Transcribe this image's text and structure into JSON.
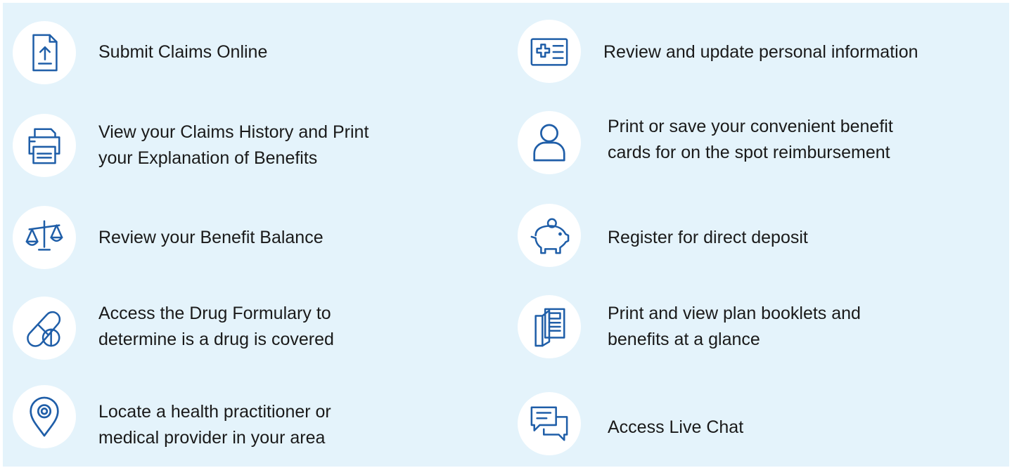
{
  "colors": {
    "panel_bg": "#e4f3fb",
    "icon_bg": "#ffffff",
    "icon_stroke": "#1f5ea8",
    "text": "#1a1a1a"
  },
  "left_column": [
    {
      "icon": "document-upload-icon",
      "lines": [
        "Submit Claims Online"
      ]
    },
    {
      "icon": "printer-icon",
      "lines": [
        "View your Claims History and Print",
        "your Explanation of Benefits"
      ]
    },
    {
      "icon": "balance-scale-icon",
      "lines": [
        "Review your Benefit Balance"
      ]
    },
    {
      "icon": "pills-icon",
      "lines": [
        "Access the Drug Formulary to",
        "determine is a drug is covered"
      ]
    },
    {
      "icon": "location-pin-icon",
      "lines": [
        "Locate a health practitioner or",
        "medical provider in your area"
      ]
    }
  ],
  "right_column": [
    {
      "icon": "health-card-icon",
      "lines": [
        "Review and update personal information"
      ]
    },
    {
      "icon": "user-icon",
      "lines": [
        "Print or save your convenient benefit",
        "cards for on the spot reimbursement"
      ]
    },
    {
      "icon": "piggy-bank-icon",
      "lines": [
        "Register for direct deposit"
      ]
    },
    {
      "icon": "booklet-icon",
      "lines": [
        "Print and view plan booklets and",
        "benefits at a glance"
      ]
    },
    {
      "icon": "chat-bubbles-icon",
      "lines": [
        "Access Live Chat"
      ]
    }
  ]
}
